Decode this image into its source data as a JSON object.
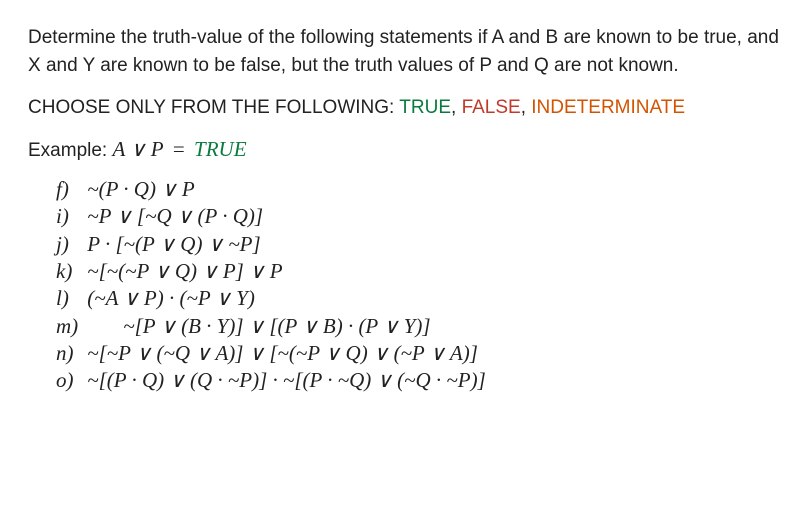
{
  "intro": "Determine the truth-value of the following statements if A and B are known to be true, and X and Y are known to be false, but the truth values of P and Q are not known.",
  "choose_prefix": "CHOOSE ONLY FROM THE FOLLOWING: ",
  "choices": {
    "true": "TRUE",
    "false": "FALSE",
    "indet": "INDETERMINATE"
  },
  "example": {
    "prefix": "Example: ",
    "formula": "A ∨ P",
    "eq": "=",
    "answer": "TRUE"
  },
  "items": {
    "f": {
      "label": "f)",
      "formula": "~(P · Q) ∨ P"
    },
    "i": {
      "label": "i)",
      "formula": "~P ∨ [~Q ∨ (P · Q)]"
    },
    "j": {
      "label": "j)",
      "formula": "P · [~(P ∨ Q) ∨ ~P]"
    },
    "k": {
      "label": "k)",
      "formula": "~[~(~P ∨ Q) ∨ P] ∨ P"
    },
    "l": {
      "label": "l)",
      "formula": "(~A ∨ P) · (~P ∨ Y)"
    },
    "m": {
      "label": "m)",
      "formula": "~[P ∨ (B · Y)] ∨ [(P ∨ B) · (P ∨ Y)]"
    },
    "n": {
      "label": "n)",
      "formula": "~[~P ∨ (~Q ∨ A)] ∨ [~(~P ∨ Q) ∨ (~P ∨ A)]"
    },
    "o": {
      "label": "o)",
      "formula": "~[(P · Q) ∨ (Q · ~P)] · ~[(P · ~Q) ∨ (~Q · ~P)]"
    }
  }
}
